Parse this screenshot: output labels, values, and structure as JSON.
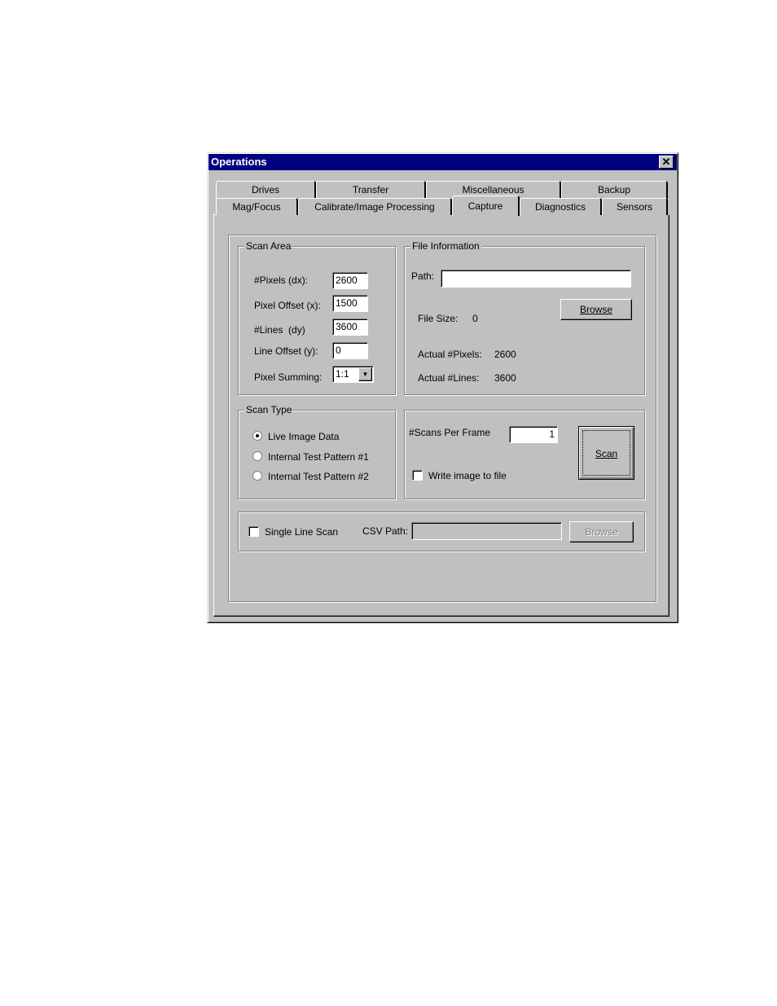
{
  "window": {
    "title": "Operations",
    "close_icon": "close-icon"
  },
  "tabs": {
    "row1": [
      "Drives",
      "Transfer",
      "Miscellaneous",
      "Backup"
    ],
    "row2": [
      "Mag/Focus",
      "Calibrate/Image Processing",
      "Capture",
      "Diagnostics",
      "Sensors"
    ],
    "active": "Capture"
  },
  "scan_area": {
    "legend": "Scan Area",
    "pixels_label": "#Pixels (dx):",
    "pixels": "2600",
    "pixel_offset_label": "Pixel Offset (x):",
    "pixel_offset": "1500",
    "lines_label": "#Lines  (dy)",
    "lines": "3600",
    "line_offset_label": "Line Offset (y):",
    "line_offset": "0",
    "summing_label": "Pixel Summing:",
    "summing": "1:1"
  },
  "file_info": {
    "legend": "File Information",
    "path_label": "Path:",
    "path": "",
    "browse": "Browse",
    "file_size_label": "File Size:",
    "file_size": "0",
    "actual_pixels_label": "Actual #Pixels:",
    "actual_pixels": "2600",
    "actual_lines_label": "Actual #Lines:",
    "actual_lines": "3600"
  },
  "scan_type": {
    "legend": "Scan Type",
    "options": [
      "Live Image Data",
      "Internal Test Pattern #1",
      "Internal Test Pattern #2"
    ],
    "selected": "Live Image Data"
  },
  "scan": {
    "scans_label": "#Scans Per Frame",
    "scans": "1",
    "write_label": "Write image to file",
    "write_checked": false,
    "scan_button": "Scan"
  },
  "bottom": {
    "single_line_label": "Single Line Scan",
    "single_line_checked": false,
    "csv_label": "CSV Path:",
    "csv_path": "",
    "browse": "Browse"
  }
}
